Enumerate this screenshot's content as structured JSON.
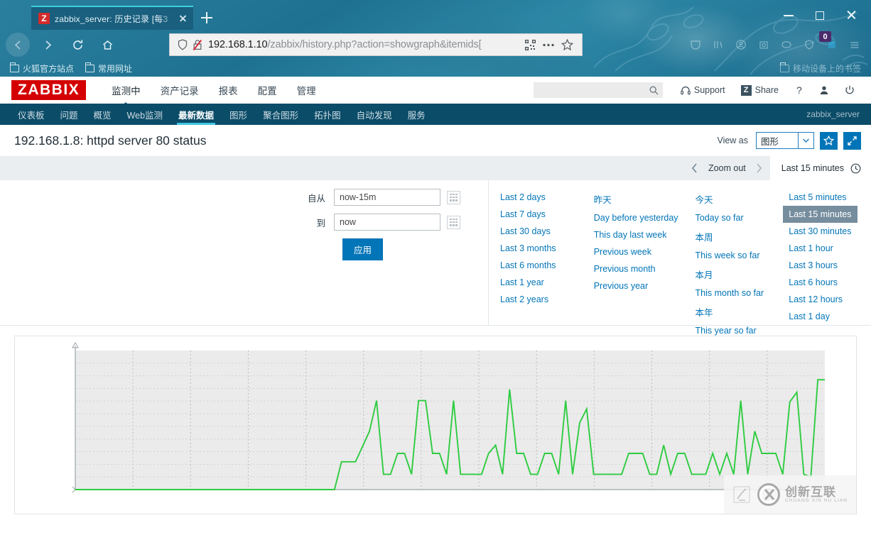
{
  "browser": {
    "tab": {
      "title": "zabbix_server: 历史记录 [每3",
      "favicon_letter": "Z",
      "close_icon": "close-icon"
    },
    "new_tab_tooltip": "+",
    "url": {
      "prefix": "192.168.1.10",
      "suffix": "/zabbix/history.php?action=showgraph&itemids["
    },
    "bookmarks": [
      {
        "label": "火狐官方站点"
      },
      {
        "label": "常用网址"
      }
    ],
    "mobile_bookmarks_label": "移动设备上的书签",
    "notification_badge": "0"
  },
  "zabbix": {
    "logo": "ZABBIX",
    "main_menu": [
      {
        "label": "监测中",
        "active": true
      },
      {
        "label": "资产记录",
        "active": false
      },
      {
        "label": "报表",
        "active": false
      },
      {
        "label": "配置",
        "active": false
      },
      {
        "label": "管理",
        "active": false
      }
    ],
    "search_placeholder": "",
    "search_value": "",
    "header_links": [
      {
        "label": "Support",
        "icon": "headset-icon"
      },
      {
        "label": "Share",
        "icon": "zabbix-share-icon"
      }
    ],
    "help_icon": "question-mark-icon",
    "user_icon": "user-icon",
    "signout_icon": "power-icon",
    "sub_menu": [
      {
        "label": "仪表板",
        "active": false
      },
      {
        "label": "问题",
        "active": false
      },
      {
        "label": "概览",
        "active": false
      },
      {
        "label": "Web监测",
        "active": false
      },
      {
        "label": "最新数据",
        "active": true
      },
      {
        "label": "图形",
        "active": false
      },
      {
        "label": "聚合图形",
        "active": false
      },
      {
        "label": "拓扑图",
        "active": false
      },
      {
        "label": "自动发现",
        "active": false
      },
      {
        "label": "服务",
        "active": false
      }
    ],
    "server_label": "zabbix_server"
  },
  "page": {
    "title": "192.168.1.8: httpd server 80 status",
    "view_as_label": "View as",
    "view_as_value": "图形",
    "favorite_icon": "star-icon",
    "fullscreen_icon": "expand-icon"
  },
  "timebar": {
    "prev_icon": "chevron-left-icon",
    "zoom_out_label": "Zoom out",
    "next_icon": "chevron-right-icon",
    "current_range": "Last 15 minutes",
    "clock_icon": "clock-icon"
  },
  "filter": {
    "from_label": "自从",
    "from_value": "now-15m",
    "to_label": "到",
    "to_value": "now",
    "apply_label": "应用",
    "calendar_icon": "calendar-icon",
    "quick_ranges": [
      [
        {
          "label": "Last 2 days",
          "selected": false
        },
        {
          "label": "Last 7 days",
          "selected": false
        },
        {
          "label": "Last 30 days",
          "selected": false
        },
        {
          "label": "Last 3 months",
          "selected": false
        },
        {
          "label": "Last 6 months",
          "selected": false
        },
        {
          "label": "Last 1 year",
          "selected": false
        },
        {
          "label": "Last 2 years",
          "selected": false
        }
      ],
      [
        {
          "label": "昨天",
          "selected": false
        },
        {
          "label": "Day before yesterday",
          "selected": false
        },
        {
          "label": "This day last week",
          "selected": false
        },
        {
          "label": "Previous week",
          "selected": false
        },
        {
          "label": "Previous month",
          "selected": false
        },
        {
          "label": "Previous year",
          "selected": false
        }
      ],
      [
        {
          "label": "今天",
          "selected": false
        },
        {
          "label": "Today so far",
          "selected": false
        },
        {
          "label": "本周",
          "selected": false
        },
        {
          "label": "This week so far",
          "selected": false
        },
        {
          "label": "本月",
          "selected": false
        },
        {
          "label": "This month so far",
          "selected": false
        },
        {
          "label": "本年",
          "selected": false
        },
        {
          "label": "This year so far",
          "selected": false
        }
      ],
      [
        {
          "label": "Last 5 minutes",
          "selected": false
        },
        {
          "label": "Last 15 minutes",
          "selected": true
        },
        {
          "label": "Last 30 minutes",
          "selected": false
        },
        {
          "label": "Last 1 hour",
          "selected": false
        },
        {
          "label": "Last 3 hours",
          "selected": false
        },
        {
          "label": "Last 6 hours",
          "selected": false
        },
        {
          "label": "Last 12 hours",
          "selected": false
        },
        {
          "label": "Last 1 day",
          "selected": false
        }
      ]
    ]
  },
  "watermark": {
    "cn": "创新互联",
    "en": "CHUANG XIN HU LIAN",
    "logo_icon": "cx-circle-logo-icon",
    "seal_icon": "seal-stamp-icon"
  },
  "chart_data": {
    "type": "line",
    "title": "192.168.1.8: httpd server 80 status",
    "xlabel": "",
    "ylabel": "",
    "grid": true,
    "legend": "none",
    "line_color": "#2ecc40",
    "plot_bg": "#ebebeb",
    "axis_color": "#9aa3a8",
    "ylim": [
      0,
      10
    ],
    "xlim": [
      0,
      100
    ],
    "series": [
      {
        "name": "httpd server 80 status",
        "values": [
          0,
          0,
          0,
          0,
          0,
          0,
          0,
          0,
          0,
          0,
          0,
          0,
          0,
          0,
          0,
          0,
          0,
          0,
          0,
          0,
          0,
          0,
          0,
          0,
          0,
          0,
          0,
          0,
          0,
          0,
          0,
          0,
          0,
          0,
          0,
          0,
          0,
          0,
          2,
          2,
          2,
          3.1,
          4.2,
          6.4,
          1.1,
          1.1,
          2.6,
          2.6,
          1.1,
          6.4,
          6.4,
          2.6,
          2.6,
          1.1,
          6.4,
          1.1,
          1.1,
          1.1,
          1.1,
          2.6,
          3.2,
          1.1,
          7.2,
          2.6,
          2.6,
          1.1,
          1.1,
          2.6,
          2.6,
          1.1,
          6.4,
          1.1,
          4.8,
          5.8,
          1.1,
          1.1,
          1.1,
          1.1,
          1.1,
          2.6,
          2.6,
          2.6,
          1.1,
          1.1,
          3.2,
          1.1,
          2.6,
          2.6,
          1.1,
          1.1,
          1.1,
          2.6,
          1.1,
          2.6,
          1.1,
          6.4,
          1.1,
          4.2,
          2.6,
          2.6,
          2.6,
          1.1,
          6.3,
          7.0,
          1.1,
          0.9,
          7.9,
          7.9
        ]
      }
    ]
  }
}
